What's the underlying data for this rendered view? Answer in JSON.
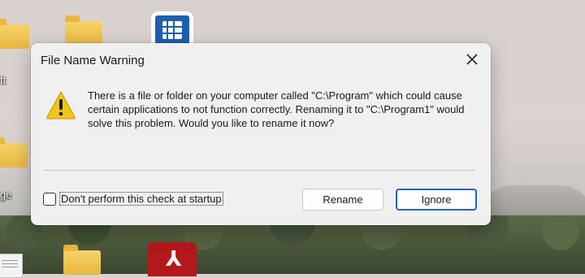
{
  "dialog": {
    "title": "File Name Warning",
    "close_icon": "close-icon",
    "warning_icon": "warning-icon",
    "message": "There is a file or folder on your computer called \"C:\\Program\" which could cause certain applications to not function correctly.  Renaming it to \"C:\\Program1\" would solve this problem.  Would you like to rename it now?",
    "checkbox_label": "Don't perform this check at startup",
    "checkbox_checked": false,
    "rename_label": "Rename",
    "ignore_label": "Ignore"
  },
  "desktop": {
    "label_left_1": "ft",
    "label_left_2": "ge"
  },
  "colors": {
    "dialog_bg": "#f0f0f0",
    "primary_button_border": "#2b62b9",
    "warning_yellow": "#f5c518"
  }
}
